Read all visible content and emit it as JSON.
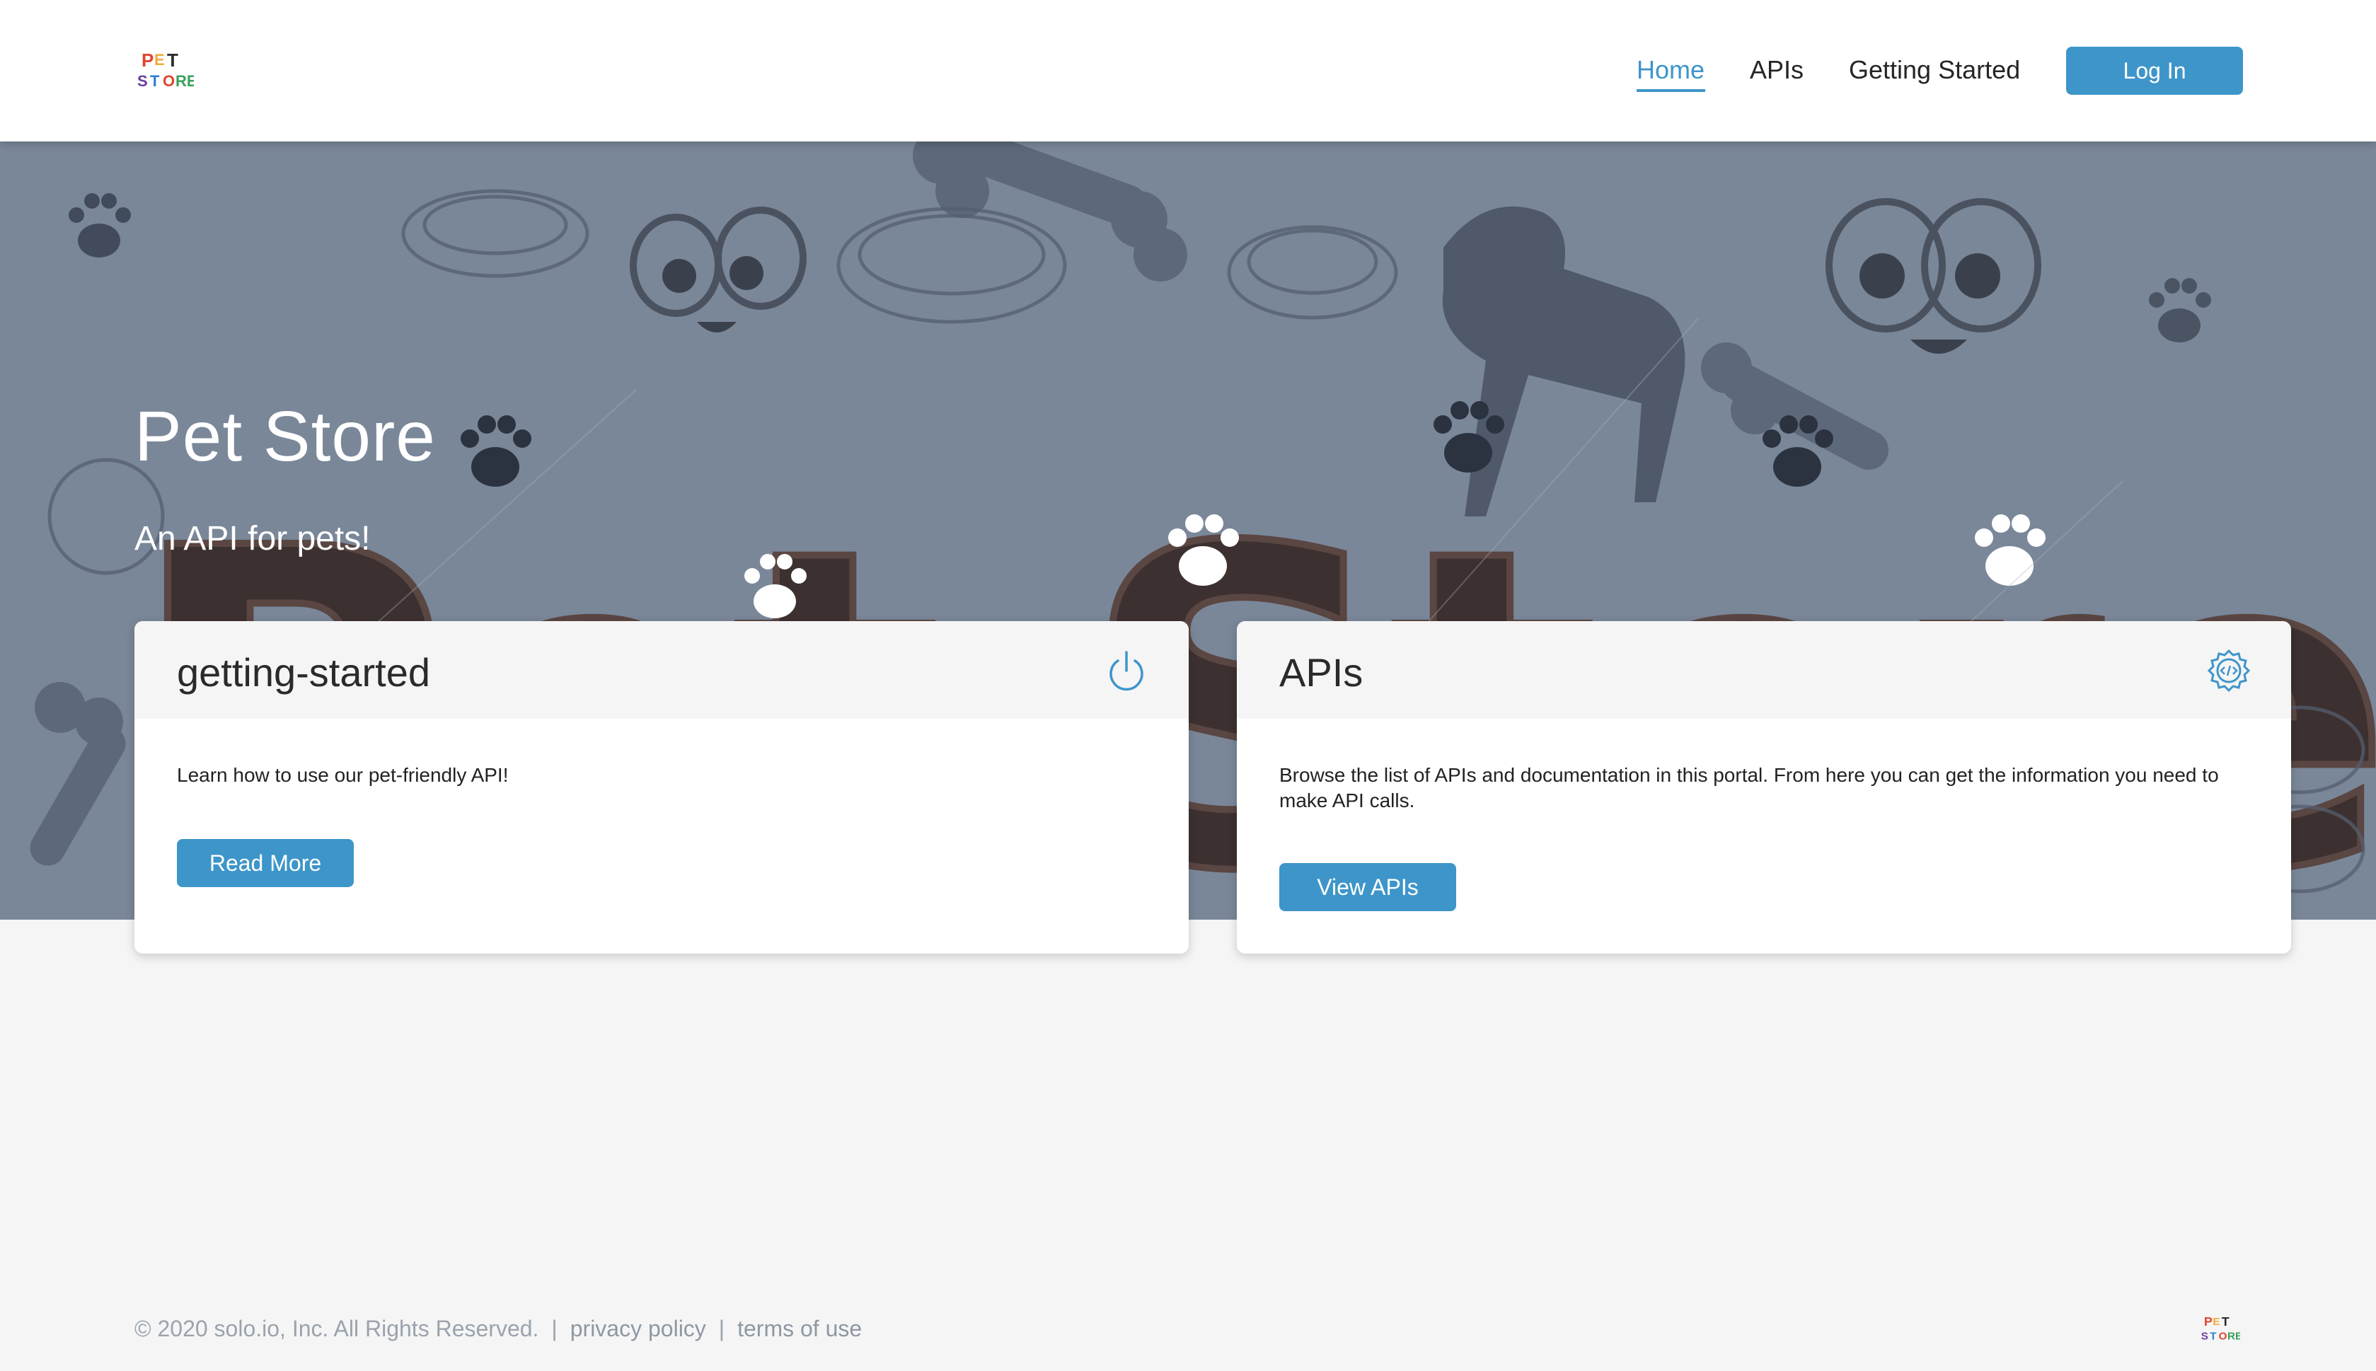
{
  "header": {
    "logo_alt": "PET STORE",
    "nav": [
      {
        "label": "Home",
        "active": true
      },
      {
        "label": "APIs",
        "active": false
      },
      {
        "label": "Getting Started",
        "active": false
      }
    ],
    "login_label": "Log In"
  },
  "hero": {
    "title": "Pet Store",
    "subtitle": "An API for pets!",
    "background_words": "Pet Store"
  },
  "cards": [
    {
      "title": "getting-started",
      "icon": "power-icon",
      "description": "Learn how to use our pet-friendly API!",
      "button_label": "Read More"
    },
    {
      "title": "APIs",
      "icon": "code-gear-icon",
      "description": "Browse the list of APIs and documentation in this portal. From here you can get the information you need to make API calls.",
      "button_label": "View APIs"
    }
  ],
  "footer": {
    "copyright": "© 2020 solo.io, Inc. All Rights Reserved.",
    "separator": "|",
    "privacy_label": "privacy policy",
    "terms_label": "terms of use"
  },
  "colors": {
    "accent": "#3e95c9",
    "hero_bg": "#7a8799",
    "page_bg": "#f5f5f5"
  }
}
